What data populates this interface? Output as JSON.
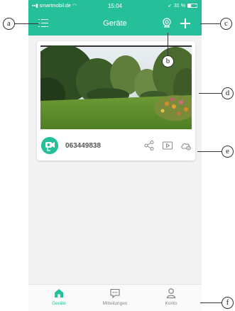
{
  "status_bar": {
    "carrier": "smartmobil.de",
    "time": "15:04",
    "battery": "31 %"
  },
  "nav": {
    "title": "Geräte"
  },
  "device": {
    "name": "063449838"
  },
  "tabs": [
    {
      "label": "Geräte",
      "active": true,
      "icon": "home-icon"
    },
    {
      "label": "Mitteilungen",
      "active": false,
      "icon": "message-icon"
    },
    {
      "label": "Konto",
      "active": false,
      "icon": "user-icon"
    }
  ],
  "callouts": {
    "a": "a",
    "b": "b",
    "c": "c",
    "d": "d",
    "e": "e",
    "f": "f"
  },
  "colors": {
    "accent": "#25c09a"
  }
}
